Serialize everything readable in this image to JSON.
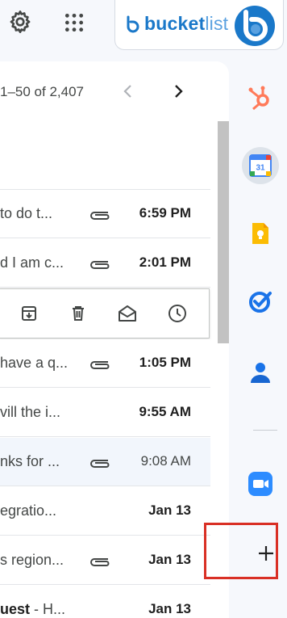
{
  "header": {
    "brand_name_part1": "bucket",
    "brand_name_part2": "list"
  },
  "pagination": {
    "range_text": "1–50 of 2,407"
  },
  "emails": [
    {
      "snippet": "to do t...",
      "has_attachment": true,
      "time": "6:59 PM",
      "unread": true
    },
    {
      "snippet": "d I am c...",
      "has_attachment": true,
      "time": "2:01 PM",
      "unread": true
    },
    {
      "snippet": "have a q...",
      "has_attachment": true,
      "time": "1:05 PM",
      "unread": true
    },
    {
      "snippet": "vill the i...",
      "has_attachment": false,
      "time": "9:55 AM",
      "unread": true
    },
    {
      "snippet": "nks for ...",
      "has_attachment": true,
      "time": "9:08 AM",
      "unread": false
    },
    {
      "snippet": "egratio...",
      "has_attachment": false,
      "time": "Jan 13",
      "unread": true
    },
    {
      "snippet": "s region...",
      "has_attachment": true,
      "time": "Jan 13",
      "unread": true
    },
    {
      "snippet_bold": "uest",
      "snippet_rest": " - H...",
      "has_attachment": false,
      "time": "Jan 13",
      "unread": true
    }
  ],
  "hover_actions": [
    "archive-icon",
    "trash-icon",
    "mark-unread-icon",
    "snooze-icon"
  ],
  "sidebar_apps": [
    "hubspot-icon",
    "google-calendar-icon",
    "google-keep-icon",
    "google-tasks-icon",
    "google-contacts-icon",
    "zoom-icon",
    "add-app-icon"
  ],
  "calendar_day": "31",
  "colors": {
    "brand_blue": "#1a78c9",
    "hubspot_orange": "#ff7a59",
    "highlight_red": "#d93025"
  }
}
